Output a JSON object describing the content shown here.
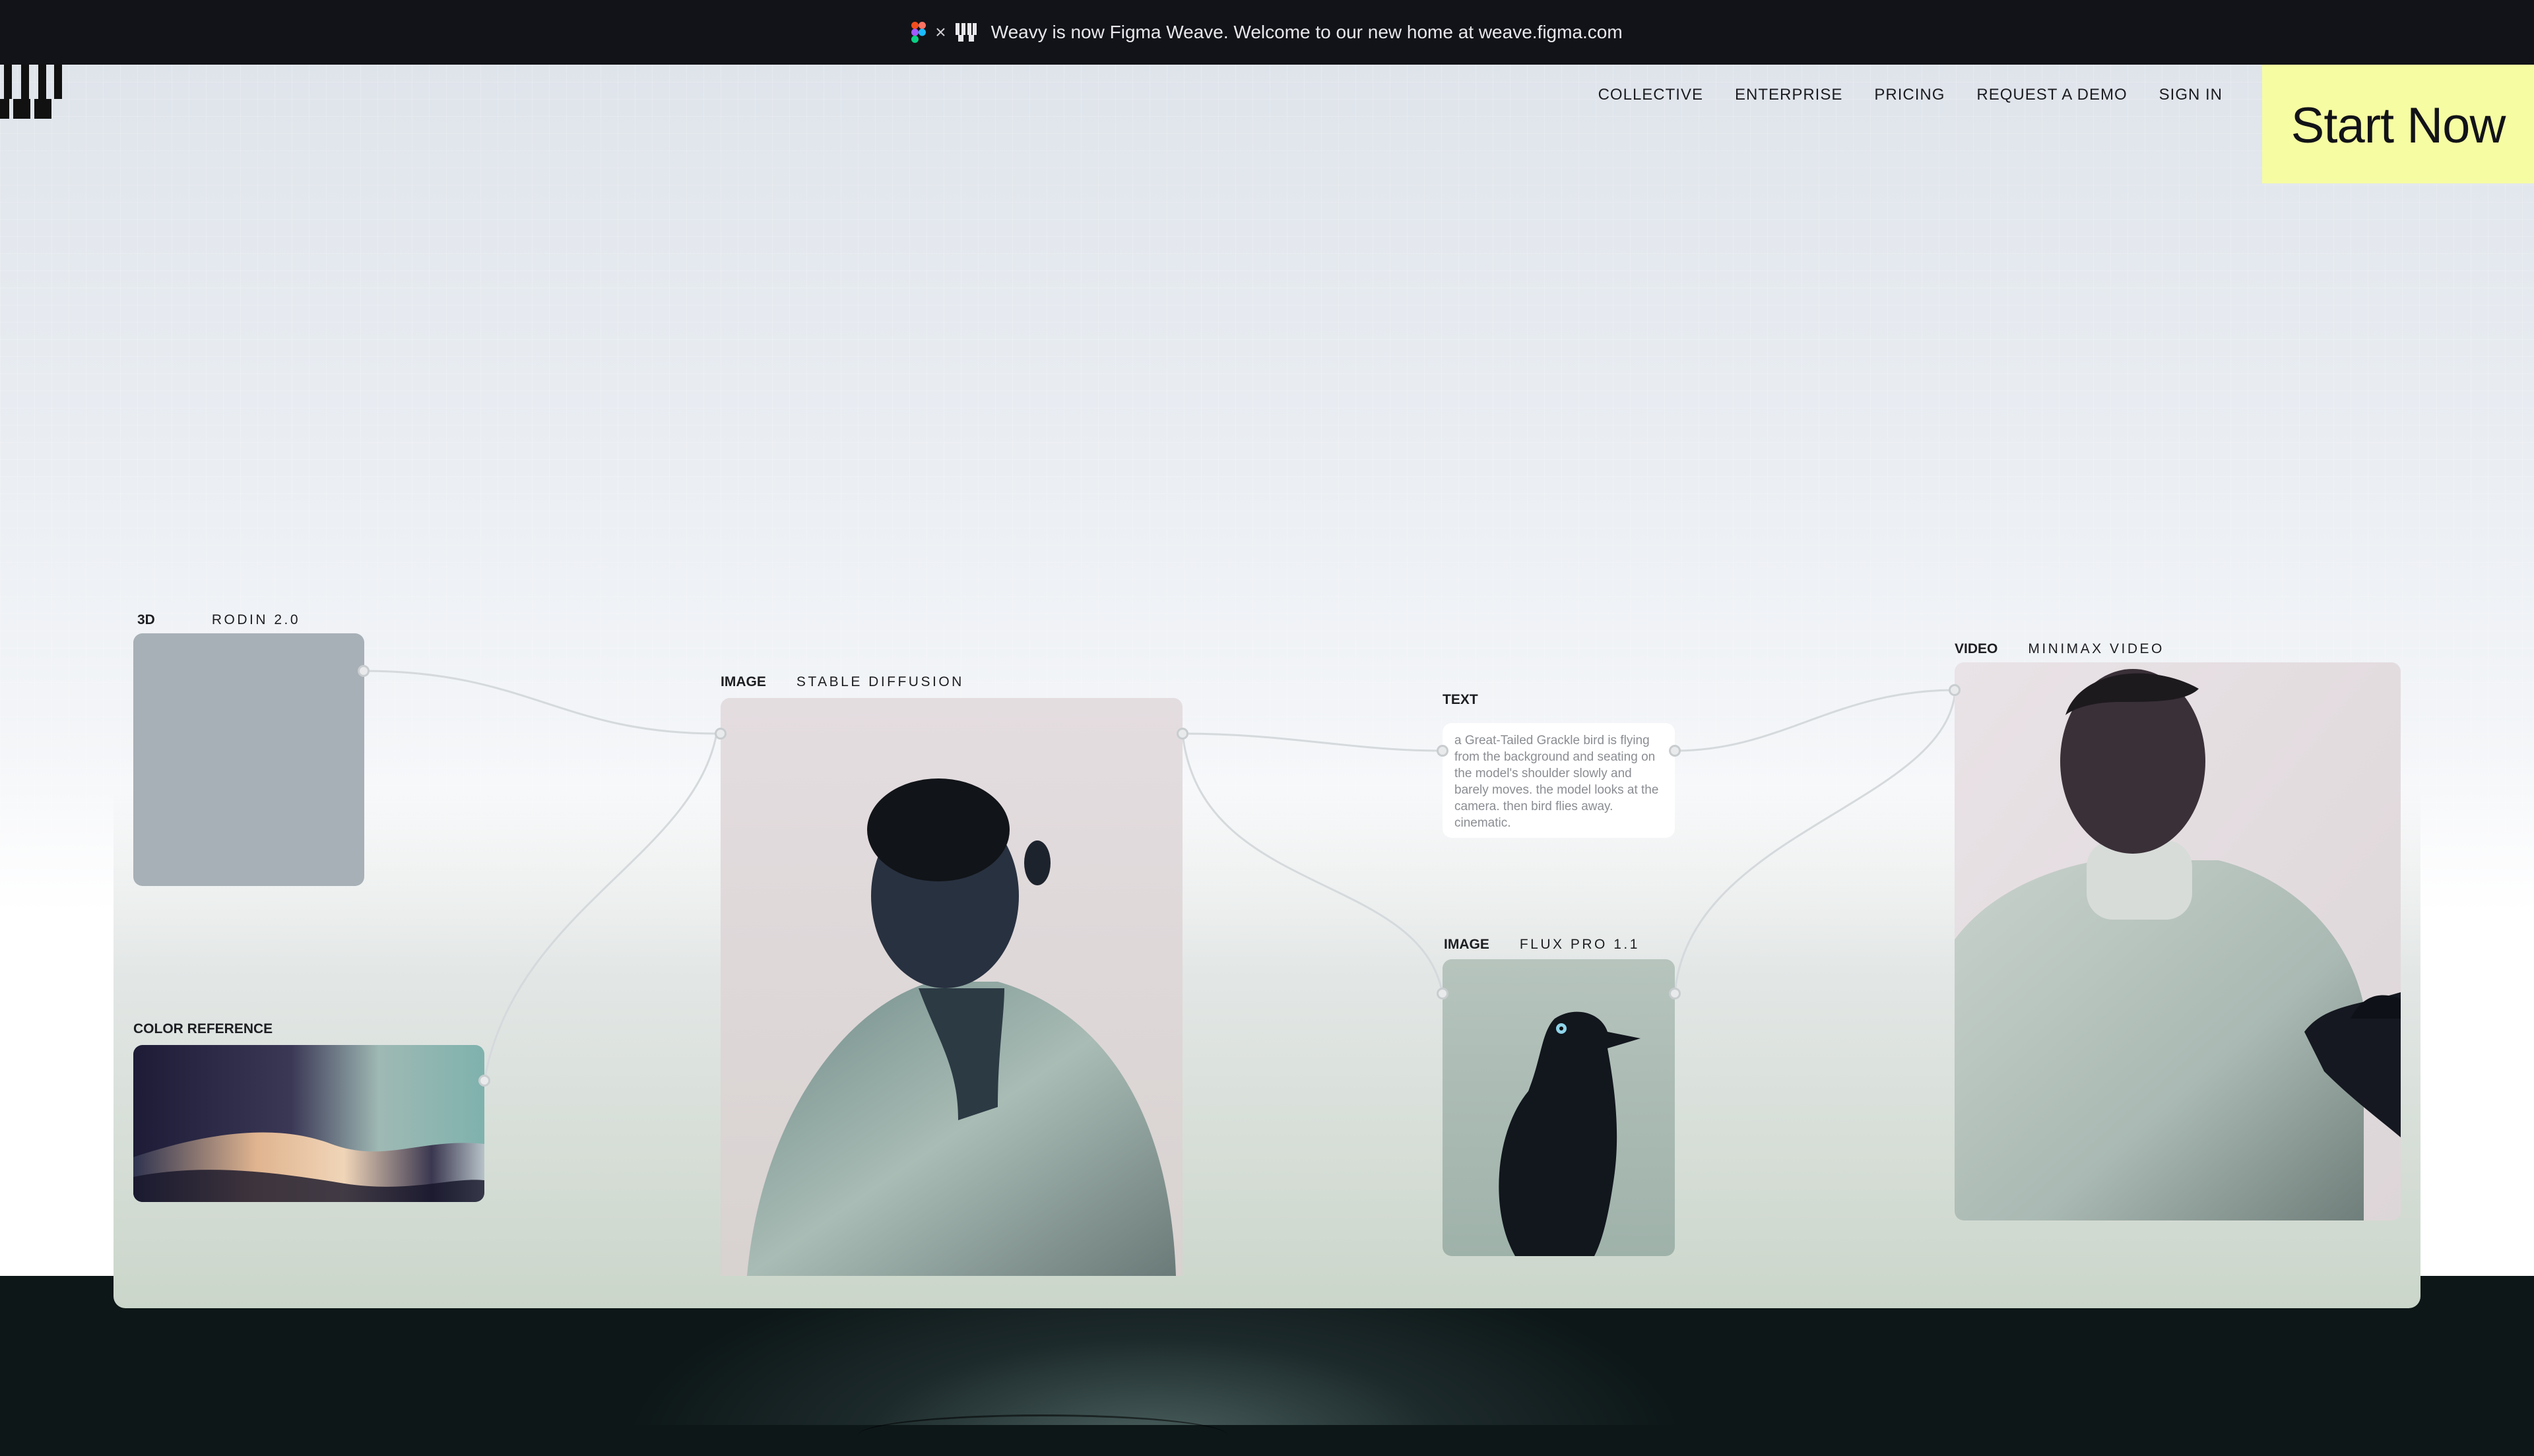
{
  "banner": {
    "times": "×",
    "message": "Weavy is now Figma Weave. Welcome to our new home at weave.figma.com"
  },
  "nav": {
    "links": [
      "COLLECTIVE",
      "ENTERPRISE",
      "PRICING",
      "REQUEST A DEMO",
      "SIGN IN"
    ],
    "cta": "Start Now"
  },
  "nodes": {
    "rodin": {
      "kind": "3D",
      "model": "RODIN 2.0"
    },
    "color_reference": {
      "kind": "COLOR REFERENCE"
    },
    "stable_diffusion": {
      "kind": "IMAGE",
      "model": "STABLE DIFFUSION"
    },
    "text": {
      "kind": "TEXT",
      "prompt": "a Great-Tailed Grackle bird is flying from the background and seating on the model's shoulder slowly and barely moves. the model looks at the camera. then bird flies away. cinematic."
    },
    "flux": {
      "kind": "IMAGE",
      "model": "FLUX PRO 1.1"
    },
    "video": {
      "kind": "VIDEO",
      "model": "MINIMAX VIDEO"
    }
  },
  "colors": {
    "banner_bg": "#121318",
    "cta_bg": "#f6fca2",
    "text_dark": "#1b1c20"
  }
}
